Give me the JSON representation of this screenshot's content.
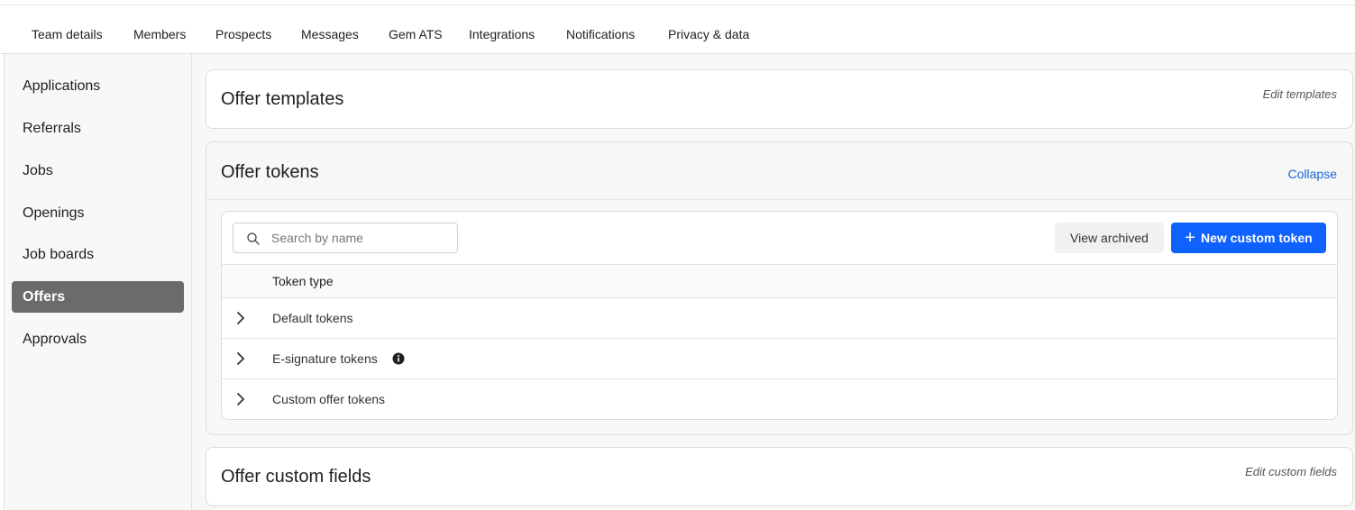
{
  "topnav": {
    "tabs": [
      {
        "label": "Team details"
      },
      {
        "label": "Members"
      },
      {
        "label": "Prospects"
      },
      {
        "label": "Messages"
      },
      {
        "label": "Gem ATS"
      },
      {
        "label": "Integrations"
      },
      {
        "label": "Notifications"
      },
      {
        "label": "Privacy & data"
      }
    ]
  },
  "sidebar": {
    "items": [
      {
        "label": "Applications"
      },
      {
        "label": "Referrals"
      },
      {
        "label": "Jobs"
      },
      {
        "label": "Openings"
      },
      {
        "label": "Job boards"
      },
      {
        "label": "Offers",
        "active": true
      },
      {
        "label": "Approvals"
      }
    ]
  },
  "offer_templates": {
    "title": "Offer templates",
    "edit_label": "Edit templates"
  },
  "offer_tokens": {
    "title": "Offer tokens",
    "collapse_label": "Collapse",
    "search": {
      "placeholder": "Search by name",
      "value": ""
    },
    "view_archived_label": "View archived",
    "new_token_label": "New custom token",
    "table": {
      "header": "Token type",
      "rows": [
        {
          "label": "Default tokens",
          "has_info_icon": false
        },
        {
          "label": "E-signature tokens",
          "has_info_icon": true
        },
        {
          "label": "Custom offer tokens",
          "has_info_icon": false
        }
      ]
    }
  },
  "offer_custom_fields": {
    "title": "Offer custom fields",
    "edit_label": "Edit custom fields"
  },
  "colors": {
    "accent": "#0f62fe",
    "link": "#1967d2",
    "active_sidebar": "#6b6b6b"
  },
  "icons": [
    "search-icon",
    "plus-icon",
    "chevron-right-icon",
    "info-icon"
  ]
}
